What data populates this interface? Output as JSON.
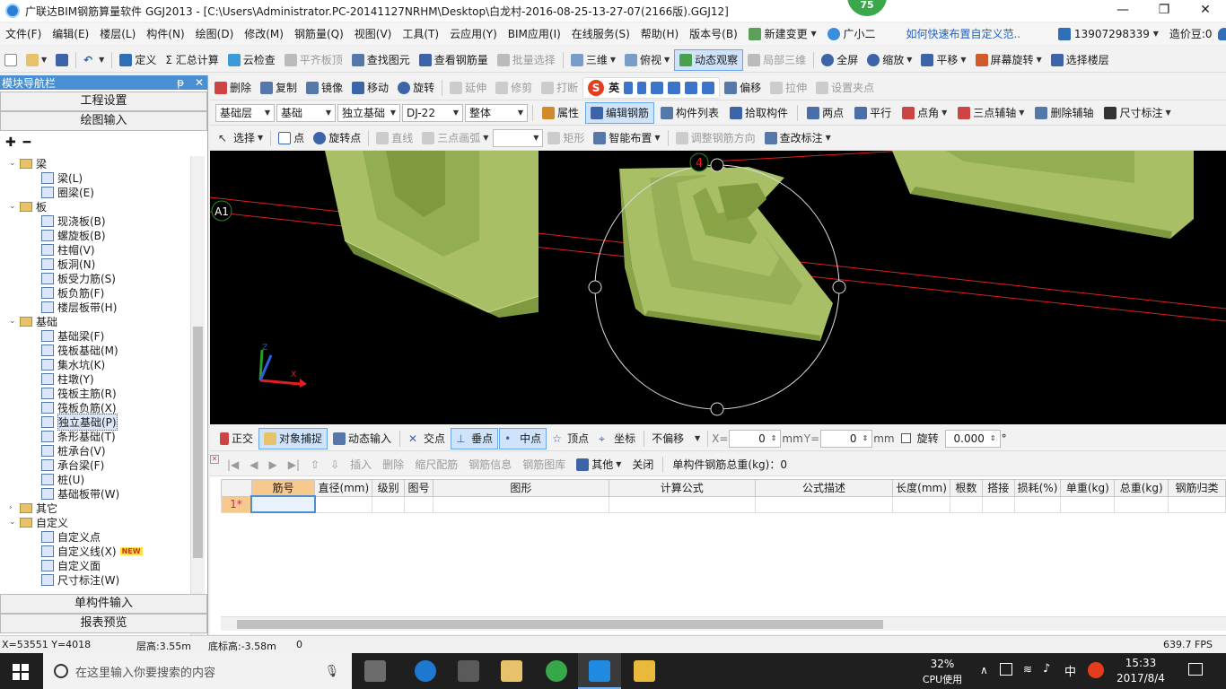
{
  "window": {
    "title": "广联达BIM钢筋算量软件 GGJ2013 - [C:\\Users\\Administrator.PC-20141127NRHM\\Desktop\\白龙村-2016-08-25-13-27-07(2166版).GGJ12]",
    "badge": "75",
    "minimize": "—",
    "maximize": "❐",
    "close": "✕"
  },
  "menu": {
    "items": [
      "文件(F)",
      "编辑(E)",
      "楼层(L)",
      "构件(N)",
      "绘图(D)",
      "修改(M)",
      "钢筋量(Q)",
      "视图(V)",
      "工具(T)",
      "云应用(Y)",
      "BIM应用(I)",
      "在线服务(S)",
      "帮助(H)",
      "版本号(B)",
      "新建变更",
      "广小二"
    ],
    "help_link": "如何快速布置自定义范..",
    "phone": "13907298339",
    "price": "造价豆:0"
  },
  "toolbar1": {
    "items": [
      "定义",
      "Σ 汇总计算",
      "云检查",
      "平齐板顶",
      "查找图元",
      "查看钢筋量",
      "批量选择",
      "三维",
      "俯视",
      "动态观察",
      "局部三维",
      "全屏",
      "缩放",
      "平移",
      "屏幕旋转",
      "选择楼层"
    ]
  },
  "toolbar2": {
    "items": [
      "删除",
      "复制",
      "镜像",
      "移动",
      "旋转",
      "延伸",
      "修剪",
      "打断",
      "偏移",
      "拉伸",
      "设置夹点"
    ],
    "ime": "英"
  },
  "toolbar3": {
    "floor": "基础层",
    "category": "基础",
    "type": "独立基础",
    "element": "DJ-22",
    "part": "整体",
    "items": [
      "属性",
      "编辑钢筋",
      "构件列表",
      "拾取构件",
      "两点",
      "平行",
      "点角",
      "三点辅轴",
      "删除辅轴",
      "尺寸标注"
    ]
  },
  "toolbar4": {
    "items": [
      "选择",
      "点",
      "旋转点",
      "直线",
      "三点画弧",
      "矩形",
      "智能布置",
      "调整钢筋方向",
      "查改标注"
    ]
  },
  "sidebar": {
    "title": "模块导航栏",
    "pin": "ᵽ",
    "close": "✕",
    "btn_project": "工程设置",
    "btn_draw": "绘图输入",
    "btn_single": "单构件输入",
    "btn_report": "报表预览",
    "tree": [
      {
        "label": "梁",
        "level": 0,
        "folder": true,
        "open": true
      },
      {
        "label": "梁(L)",
        "level": 1
      },
      {
        "label": "圈梁(E)",
        "level": 1
      },
      {
        "label": "板",
        "level": 0,
        "folder": true,
        "open": true
      },
      {
        "label": "现浇板(B)",
        "level": 1
      },
      {
        "label": "螺旋板(B)",
        "level": 1
      },
      {
        "label": "柱帽(V)",
        "level": 1
      },
      {
        "label": "板洞(N)",
        "level": 1
      },
      {
        "label": "板受力筋(S)",
        "level": 1
      },
      {
        "label": "板负筋(F)",
        "level": 1
      },
      {
        "label": "楼层板带(H)",
        "level": 1
      },
      {
        "label": "基础",
        "level": 0,
        "folder": true,
        "open": true
      },
      {
        "label": "基础梁(F)",
        "level": 1
      },
      {
        "label": "筏板基础(M)",
        "level": 1
      },
      {
        "label": "集水坑(K)",
        "level": 1
      },
      {
        "label": "柱墩(Y)",
        "level": 1
      },
      {
        "label": "筏板主筋(R)",
        "level": 1
      },
      {
        "label": "筏板负筋(X)",
        "level": 1
      },
      {
        "label": "独立基础(P)",
        "level": 1,
        "selected": true
      },
      {
        "label": "条形基础(T)",
        "level": 1
      },
      {
        "label": "桩承台(V)",
        "level": 1
      },
      {
        "label": "承台梁(F)",
        "level": 1
      },
      {
        "label": "桩(U)",
        "level": 1
      },
      {
        "label": "基础板带(W)",
        "level": 1
      },
      {
        "label": "其它",
        "level": 0,
        "folder": true,
        "open": false
      },
      {
        "label": "自定义",
        "level": 0,
        "folder": true,
        "open": true
      },
      {
        "label": "自定义点",
        "level": 1
      },
      {
        "label": "自定义线(X)",
        "level": 1,
        "new": "NEW"
      },
      {
        "label": "自定义面",
        "level": 1
      },
      {
        "label": "尺寸标注(W)",
        "level": 1
      }
    ]
  },
  "canvas": {
    "axis_label_4": "4",
    "axis_label_a1": "A1"
  },
  "snapbar": {
    "items": [
      "正交",
      "对象捕捉",
      "动态输入",
      "交点",
      "垂点",
      "中点",
      "顶点",
      "坐标"
    ],
    "offset": "不偏移",
    "x_label": "X=",
    "x_value": "0",
    "y_label": "Y=",
    "y_value": "0",
    "unit": "mm",
    "rotate_label": "旋转",
    "rotate_value": "0.000",
    "deg": "°"
  },
  "rebar_toolbar": {
    "items": [
      "插入",
      "删除",
      "缩尺配筋",
      "钢筋信息",
      "钢筋图库",
      "其他",
      "关闭"
    ],
    "total": "单构件钢筋总重(kg)：0"
  },
  "rebar_table": {
    "columns": [
      "筋号",
      "直径(mm)",
      "级别",
      "图号",
      "图形",
      "计算公式",
      "公式描述",
      "长度(mm)",
      "根数",
      "搭接",
      "损耗(%)",
      "单重(kg)",
      "总重(kg)",
      "钢筋归类"
    ],
    "row_label": "1*"
  },
  "status": {
    "coords": "X=53551 Y=4018",
    "floor_height": "层高:3.55m",
    "base_elev": "底标高:-3.58m",
    "value": "0",
    "fps": "639.7 FPS"
  },
  "taskbar": {
    "search_placeholder": "在这里输入你要搜索的内容",
    "cpu_percent": "32%",
    "cpu_label": "CPU使用",
    "ime": "中",
    "time": "15:33",
    "date": "2017/8/4"
  },
  "colors": {
    "footing": "#a8bf66",
    "footing_dark": "#7f9a3e",
    "axis_red": "#e02020",
    "selection": "#4a8fd1"
  }
}
